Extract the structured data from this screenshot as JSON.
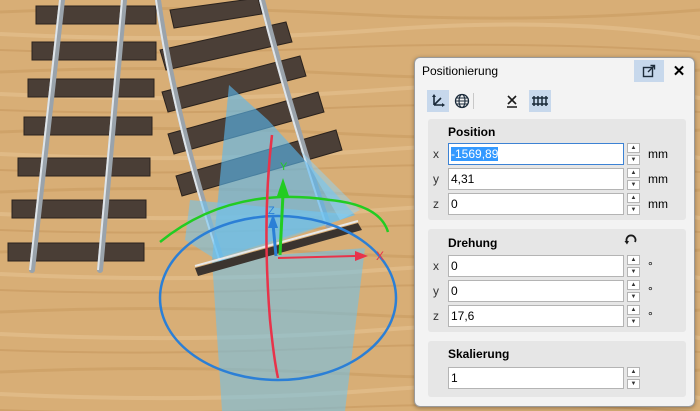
{
  "panel": {
    "title": "Positionierung",
    "tabs": [
      {
        "name": "move-gizmo",
        "active": true
      },
      {
        "name": "globe",
        "active": false
      },
      {
        "name": "reset",
        "active": false
      },
      {
        "name": "track",
        "active": true
      }
    ]
  },
  "position": {
    "label": "Position",
    "x": {
      "axis": "x",
      "value": "-1569,89",
      "unit": "mm"
    },
    "y": {
      "axis": "y",
      "value": "4,31",
      "unit": "mm"
    },
    "z": {
      "axis": "z",
      "value": "0",
      "unit": "mm"
    }
  },
  "rotation": {
    "label": "Drehung",
    "x": {
      "axis": "x",
      "value": "0",
      "unit": "°"
    },
    "y": {
      "axis": "y",
      "value": "0",
      "unit": "°"
    },
    "z": {
      "axis": "z",
      "value": "17,6",
      "unit": "°"
    }
  },
  "scale": {
    "label": "Skalierung",
    "value": "1"
  },
  "gizmo": {
    "x_label": "X",
    "y_label": "Y",
    "z_label": "Z"
  },
  "colors": {
    "x_axis": "#e8334a",
    "y_axis": "#22cc22",
    "z_axis": "#2b7fd6",
    "wood": "#d9b07a",
    "accent": "#3399ff"
  }
}
